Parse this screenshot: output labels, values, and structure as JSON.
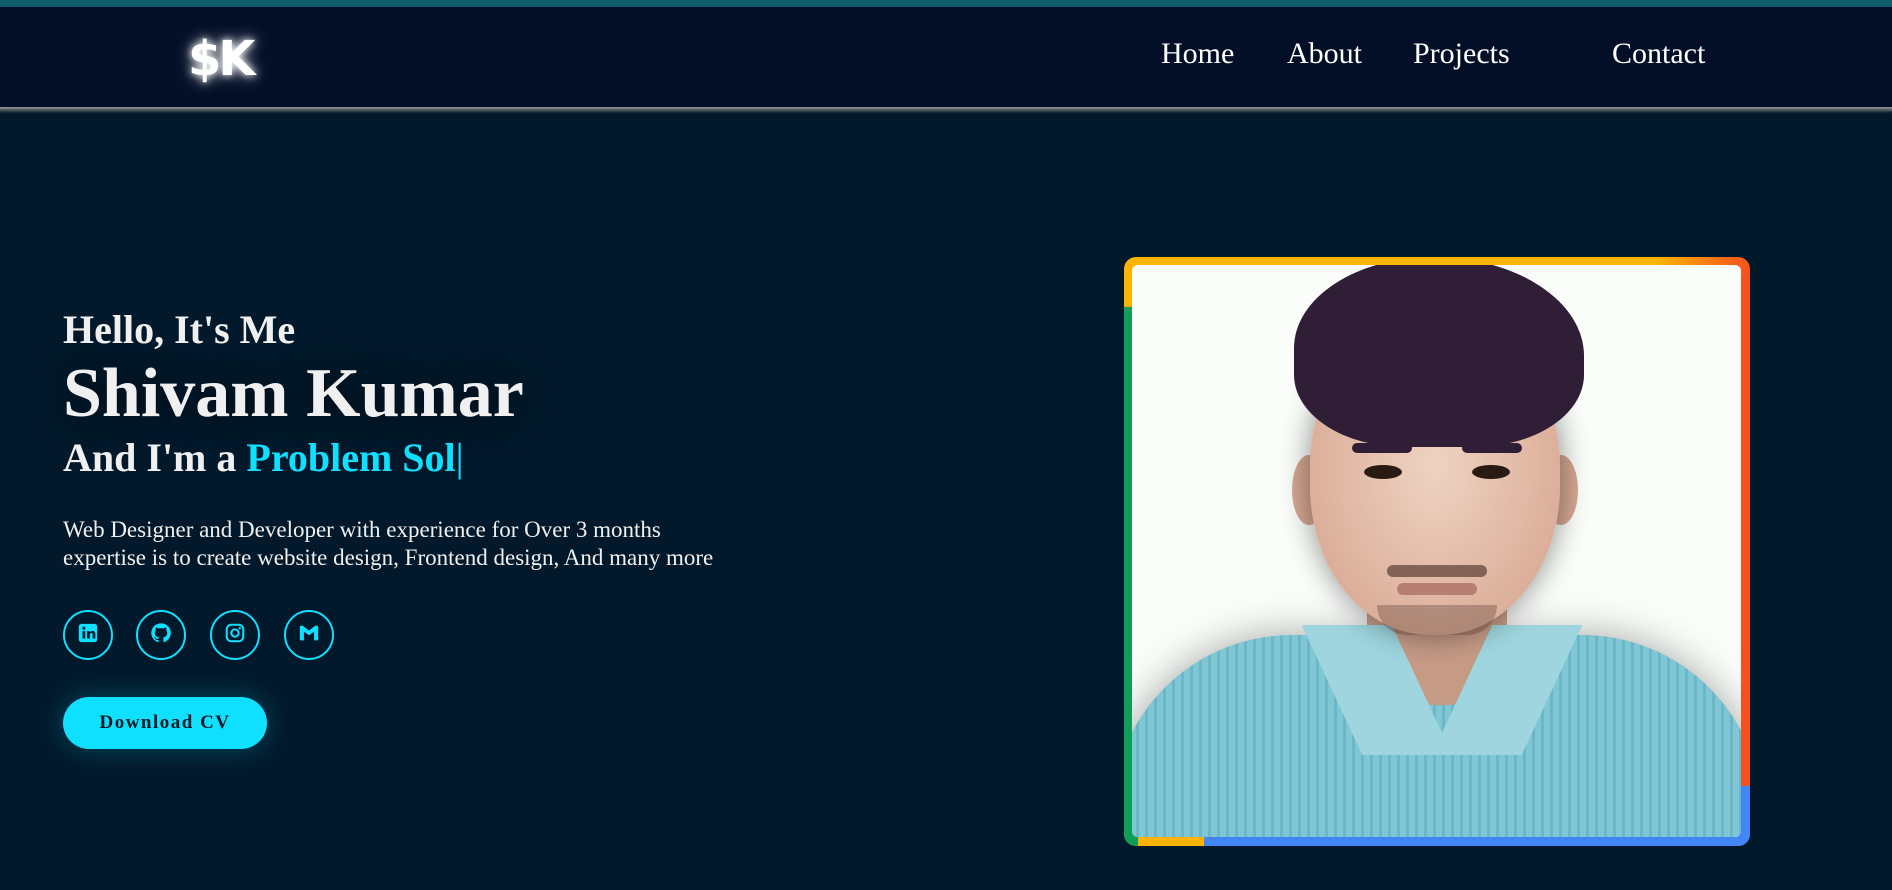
{
  "brand": {
    "logo_text": "$K"
  },
  "nav": {
    "items": [
      {
        "label": "Home"
      },
      {
        "label": "About"
      },
      {
        "label": "Projects"
      },
      {
        "label": "Contact"
      }
    ]
  },
  "hero": {
    "greeting": "Hello, It's Me",
    "name": "Shivam Kumar",
    "role_prefix": "And I'm a",
    "role_typed": "Problem Sol",
    "caret": "|",
    "description_line1": "Web Designer and Developer with experience for Over 3 months",
    "description_line2": "expertise is to create website design, Frontend design, And many more",
    "socials": [
      {
        "icon": "linkedin-icon"
      },
      {
        "icon": "github-icon"
      },
      {
        "icon": "instagram-icon"
      },
      {
        "icon": "gmail-icon"
      }
    ],
    "cv_button": "Download CV"
  },
  "colors": {
    "background": "#02192b",
    "navbar": "#030f27",
    "accent": "#0fe0ff",
    "frame_yellow": "#fbb404",
    "frame_red": "#f4511e",
    "frame_green": "#0f9d58",
    "frame_blue": "#4285f4"
  }
}
